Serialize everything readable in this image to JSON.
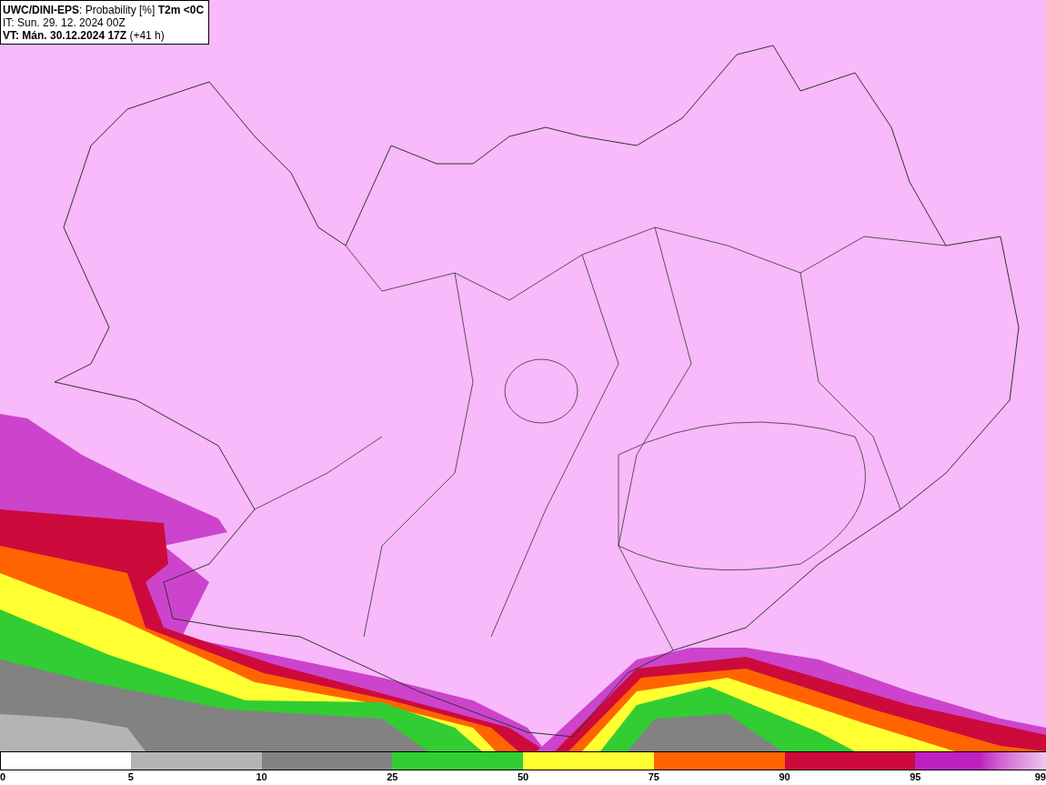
{
  "header": {
    "lines": [
      "**UWC/DINI-EPS**: Probability [%] **T2m <0C**",
      "IT: Sun. 29. 12. 2024 00Z",
      "**VT: Mán. 30.12.2024 17Z** (+41 h)"
    ]
  },
  "legend": {
    "segments": [
      {
        "color": "#ffffff"
      },
      {
        "color": "#b4b4b4"
      },
      {
        "color": "#828282"
      },
      {
        "color": "#32cd32"
      },
      {
        "color": "#ffff32"
      },
      {
        "color": "#ff6400"
      },
      {
        "color": "#cd0a3c"
      },
      {
        "color": "#c020c0",
        "gradient": true
      }
    ],
    "labels": [
      "0",
      "5",
      "10",
      "25",
      "50",
      "75",
      "90",
      "95",
      "99"
    ]
  }
}
